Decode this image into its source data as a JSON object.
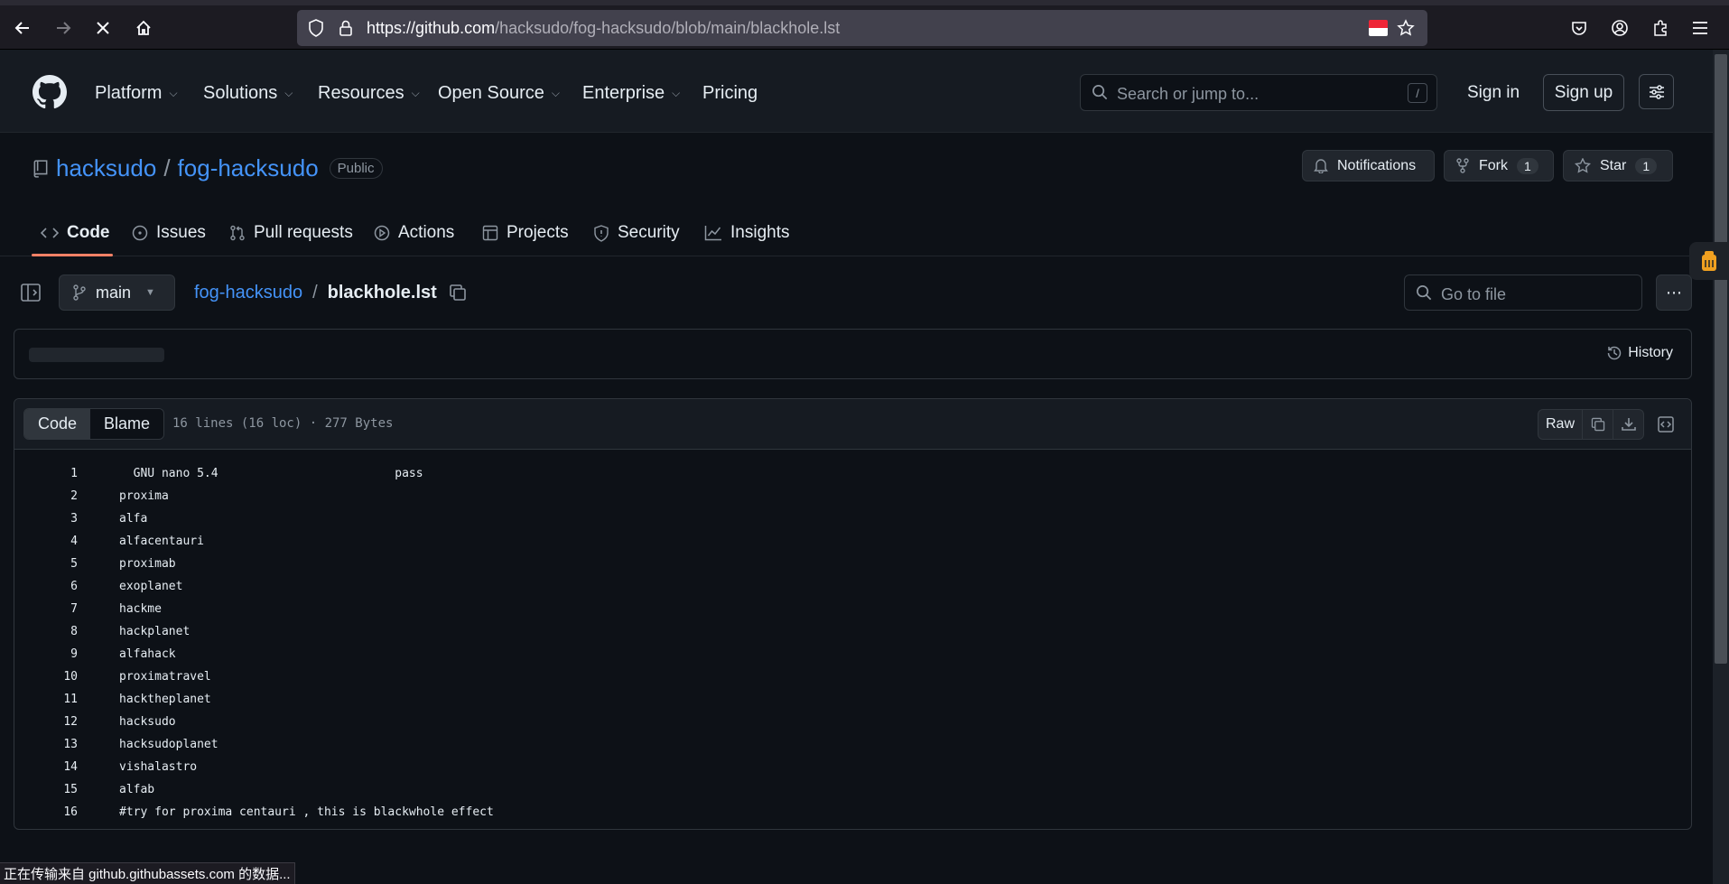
{
  "browser": {
    "url_host": "https://github.com",
    "url_path": "/hacksudo/fog-hacksudo/blob/main/blackhole.lst"
  },
  "header": {
    "nav": [
      {
        "label": "Platform",
        "has_menu": true
      },
      {
        "label": "Solutions",
        "has_menu": true
      },
      {
        "label": "Resources",
        "has_menu": true
      },
      {
        "label": "Open Source",
        "has_menu": true
      },
      {
        "label": "Enterprise",
        "has_menu": true
      },
      {
        "label": "Pricing",
        "has_menu": false
      }
    ],
    "search_placeholder": "Search or jump to...",
    "search_shortcut": "/",
    "sign_in": "Sign in",
    "sign_up": "Sign up"
  },
  "repo": {
    "owner": "hacksudo",
    "separator": "/",
    "name": "fog-hacksudo",
    "visibility": "Public",
    "notifications_label": "Notifications",
    "fork_label": "Fork",
    "fork_count": "1",
    "star_label": "Star",
    "star_count": "1"
  },
  "tabs": [
    {
      "label": "Code",
      "icon": "code-icon",
      "active": true
    },
    {
      "label": "Issues",
      "icon": "issue-icon"
    },
    {
      "label": "Pull requests",
      "icon": "pull-request-icon"
    },
    {
      "label": "Actions",
      "icon": "play-icon"
    },
    {
      "label": "Projects",
      "icon": "table-icon"
    },
    {
      "label": "Security",
      "icon": "shield-icon"
    },
    {
      "label": "Insights",
      "icon": "graph-icon"
    }
  ],
  "file_nav": {
    "branch": "main",
    "breadcrumb_repo": "fog-hacksudo",
    "breadcrumb_sep": "/",
    "file_name": "blackhole.lst",
    "goto_placeholder": "Go to file",
    "history_label": "History"
  },
  "file": {
    "view_code": "Code",
    "view_blame": "Blame",
    "info": "16 lines (16 loc) · 277 Bytes",
    "raw_label": "Raw",
    "lines": [
      "  GNU nano 5.4                         pass",
      "proxima",
      "alfa",
      "alfacentauri",
      "proximab",
      "exoplanet",
      "hackme",
      "hackplanet",
      "alfahack",
      "proximatravel",
      "hacktheplanet",
      "hacksudo",
      "hacksudoplanet",
      "vishalastro",
      "alfab",
      "#try for proxima centauri , this is blackwhole effect"
    ]
  },
  "status_bar": "正在传输来自 github.githubassets.com 的数据...",
  "colors": {
    "accent_link": "#4493f8",
    "tab_underline": "#f78166",
    "background": "#0d1117"
  }
}
